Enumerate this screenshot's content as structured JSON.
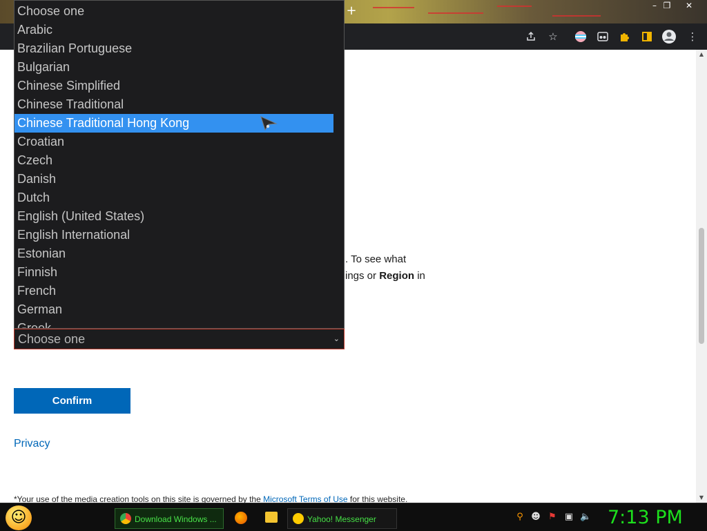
{
  "browser": {
    "new_tab_label": "+",
    "window_controls": [
      "–",
      "❐",
      "✕"
    ],
    "toolbar_icons": [
      "share-icon",
      "star-icon",
      "extension-trans-icon",
      "extension-glasses-icon",
      "puzzle-icon",
      "sidebar-icon",
      "profile-icon",
      "menu-icon"
    ]
  },
  "page": {
    "text_line1": ". To see what",
    "text_line2_pre": "ings or ",
    "text_line2_bold": "Region",
    "text_line2_post": " in",
    "language_select": {
      "selected": "Choose one",
      "chevron": "⌄"
    },
    "confirm_label": "Confirm",
    "privacy_label": "Privacy",
    "footnote_pre": "*Your use of the media creation tools on this site is governed by the ",
    "footnote_link": "Microsoft Terms of Use",
    "footnote_post": " for this website."
  },
  "dropdown": {
    "options": [
      "Choose one",
      "Arabic",
      "Brazilian Portuguese",
      "Bulgarian",
      "Chinese Simplified",
      "Chinese Traditional",
      "Chinese Traditional Hong Kong",
      "Croatian",
      "Czech",
      "Danish",
      "Dutch",
      "English (United States)",
      "English International",
      "Estonian",
      "Finnish",
      "French",
      "German",
      "Greek"
    ],
    "highlighted_index": 6
  },
  "taskbar": {
    "tasks": [
      {
        "label": "Download Windows ...",
        "icon": "chrome-icon"
      },
      {
        "label": "Yahoo! Messenger",
        "icon": "yahoo-messenger-icon"
      }
    ],
    "pinned": [
      "firefox-icon",
      "folder-icon"
    ],
    "tray": [
      "search-icon",
      "emoticon-icon",
      "flag-icon",
      "network-icon",
      "volume-icon"
    ],
    "clock": "7:13 PM"
  },
  "colors": {
    "accent": "#0067b8",
    "highlight": "#3391f0",
    "clock": "#1de01d"
  }
}
